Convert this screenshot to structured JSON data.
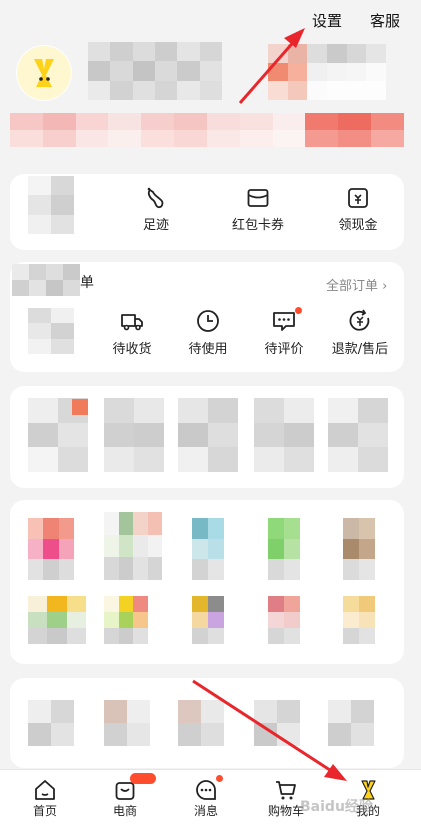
{
  "header": {
    "settings_label": "设置",
    "service_label": "客服"
  },
  "shortcuts": [
    {
      "label": "足迹",
      "icon": "footprint-icon"
    },
    {
      "label": "红包卡券",
      "icon": "wallet-icon"
    },
    {
      "label": "领现金",
      "icon": "cash-icon"
    }
  ],
  "orders": {
    "all_orders_label": "全部订单",
    "all_orders_chevron": "›",
    "section_title_fragment": "单",
    "items": [
      {
        "label": "待收货",
        "icon": "truck-icon"
      },
      {
        "label": "待使用",
        "icon": "clock-icon"
      },
      {
        "label": "待评价",
        "icon": "comment-icon"
      },
      {
        "label": "退款/售后",
        "icon": "refund-icon"
      }
    ]
  },
  "tabbar": [
    {
      "label": "首页",
      "icon": "home-icon"
    },
    {
      "label": "电商",
      "icon": "shop-icon"
    },
    {
      "label": "消息",
      "icon": "message-icon"
    },
    {
      "label": "购物车",
      "icon": "cart-icon"
    },
    {
      "label": "我的",
      "icon": "profile-icon"
    }
  ],
  "colors": {
    "accent": "#ff4d2e",
    "annotation_arrow": "#e8262c",
    "mascot": "#ffd21a"
  },
  "watermark": "Baidu经验"
}
